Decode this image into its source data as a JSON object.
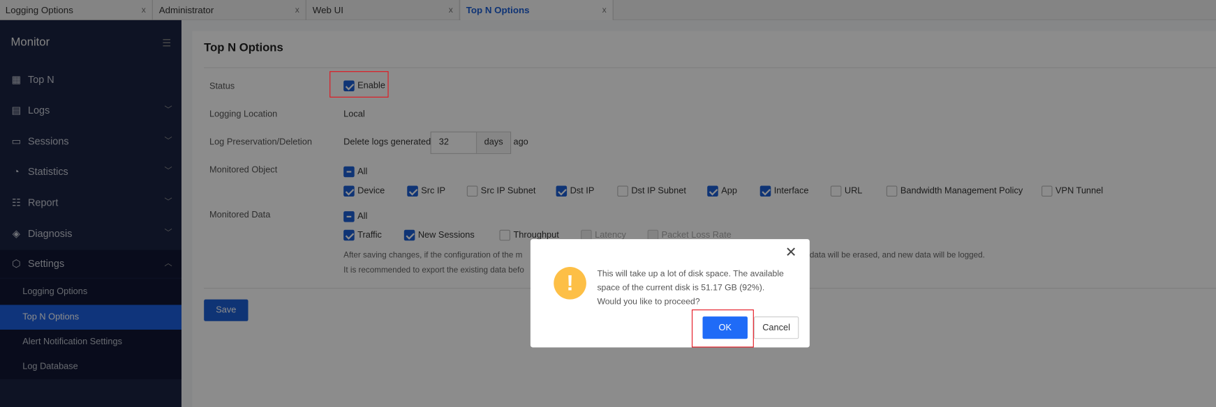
{
  "tabs": [
    {
      "label": "Logging Options",
      "close": "x"
    },
    {
      "label": "Administrator",
      "close": "x"
    },
    {
      "label": "Web UI",
      "close": "x"
    },
    {
      "label": "Top N Options",
      "close": "x",
      "active": true
    }
  ],
  "sidebar": {
    "title": "Monitor",
    "collapse_icon": "menu-fold-icon",
    "items": [
      {
        "label": "Top N",
        "icon": "grid-icon"
      },
      {
        "label": "Logs",
        "icon": "document-icon"
      },
      {
        "label": "Sessions",
        "icon": "chat-icon"
      },
      {
        "label": "Statistics",
        "icon": "pie-chart-icon"
      },
      {
        "label": "Report",
        "icon": "list-icon"
      },
      {
        "label": "Diagnosis",
        "icon": "diagnosis-icon"
      },
      {
        "label": "Settings",
        "icon": "settings-icon"
      }
    ],
    "settings_sub": [
      "Logging Options",
      "Top N Options",
      "Alert Notification Settings",
      "Log Database"
    ]
  },
  "page": {
    "title": "Top N Options",
    "status_label": "Status",
    "status_value": "Enable",
    "location_label": "Logging Location",
    "location_value": "Local",
    "preservation_label": "Log Preservation/Deletion",
    "preservation_prefix": "Delete logs generated",
    "days_value": "32",
    "days_unit": "days",
    "preservation_suffix": "ago",
    "monitored_object_label": "Monitored Object",
    "monitored_object_all": "All",
    "monitored_objects": [
      {
        "label": "Device",
        "checked": true
      },
      {
        "label": "Src IP",
        "checked": true
      },
      {
        "label": "Src IP Subnet",
        "checked": false
      },
      {
        "label": "Dst IP",
        "checked": true
      },
      {
        "label": "Dst IP Subnet",
        "checked": false
      },
      {
        "label": "App",
        "checked": true
      },
      {
        "label": "Interface",
        "checked": true
      },
      {
        "label": "URL",
        "checked": false
      },
      {
        "label": "Bandwidth Management Policy",
        "checked": false
      },
      {
        "label": "VPN Tunnel",
        "checked": false
      }
    ],
    "monitored_data_label": "Monitored Data",
    "monitored_data_all": "All",
    "monitored_data": [
      {
        "label": "Traffic",
        "checked": true
      },
      {
        "label": "New Sessions",
        "checked": true
      },
      {
        "label": "Throughput",
        "checked": false
      },
      {
        "label": "Latency",
        "checked": false,
        "disabled": true
      },
      {
        "label": "Packet Loss Rate",
        "checked": false,
        "disabled": true
      }
    ],
    "note1_a": "After saving changes, if the configuration of the m",
    "note1_b": "data will be erased, and new data will be logged.",
    "note2": "It is recommended to export the existing data befo",
    "save": "Save"
  },
  "dialog": {
    "line1": "This will take up a lot of disk space. The available",
    "line2": "space of the current disk is 51.17 GB (92%).",
    "line3": "Would you like to proceed?",
    "ok": "OK",
    "cancel": "Cancel",
    "close": "✕",
    "warn": "!"
  },
  "colors": {
    "accent": "#1d5fd6",
    "highlight": "#e5131d",
    "warning": "#fdbf46"
  }
}
